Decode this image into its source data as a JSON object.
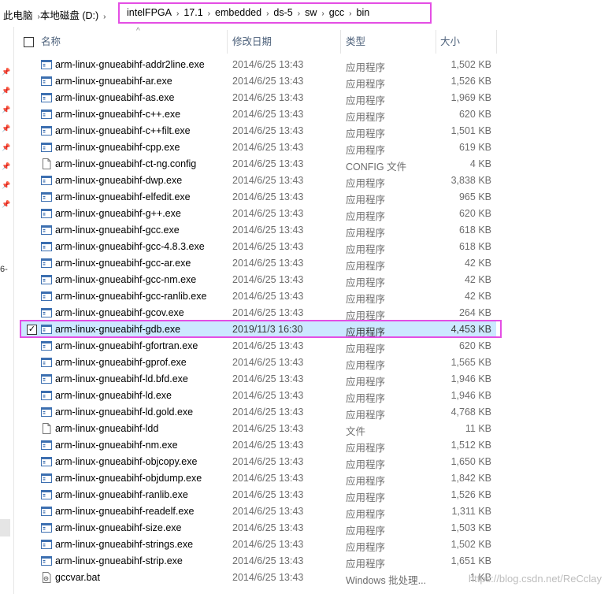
{
  "breadcrumb": {
    "prefix": [
      "此电脑",
      "本地磁盘 (D:)"
    ],
    "items": [
      "intelFPGA",
      "17.1",
      "embedded",
      "ds-5",
      "sw",
      "gcc",
      "bin"
    ]
  },
  "nav": {
    "partial_text": "6-"
  },
  "columns": {
    "name": "名称",
    "date": "修改日期",
    "type": "类型",
    "size": "大小"
  },
  "files": [
    {
      "name": "arm-linux-gnueabihf-addr2line.exe",
      "date": "2014/6/25 13:43",
      "type": "应用程序",
      "size": "1,502 KB",
      "icon": "exe-icon"
    },
    {
      "name": "arm-linux-gnueabihf-ar.exe",
      "date": "2014/6/25 13:43",
      "type": "应用程序",
      "size": "1,526 KB",
      "icon": "exe-icon"
    },
    {
      "name": "arm-linux-gnueabihf-as.exe",
      "date": "2014/6/25 13:43",
      "type": "应用程序",
      "size": "1,969 KB",
      "icon": "exe-icon"
    },
    {
      "name": "arm-linux-gnueabihf-c++.exe",
      "date": "2014/6/25 13:43",
      "type": "应用程序",
      "size": "620 KB",
      "icon": "exe-icon"
    },
    {
      "name": "arm-linux-gnueabihf-c++filt.exe",
      "date": "2014/6/25 13:43",
      "type": "应用程序",
      "size": "1,501 KB",
      "icon": "exe-icon"
    },
    {
      "name": "arm-linux-gnueabihf-cpp.exe",
      "date": "2014/6/25 13:43",
      "type": "应用程序",
      "size": "619 KB",
      "icon": "exe-icon"
    },
    {
      "name": "arm-linux-gnueabihf-ct-ng.config",
      "date": "2014/6/25 13:43",
      "type": "CONFIG 文件",
      "size": "4 KB",
      "icon": "file-icon"
    },
    {
      "name": "arm-linux-gnueabihf-dwp.exe",
      "date": "2014/6/25 13:43",
      "type": "应用程序",
      "size": "3,838 KB",
      "icon": "exe-icon"
    },
    {
      "name": "arm-linux-gnueabihf-elfedit.exe",
      "date": "2014/6/25 13:43",
      "type": "应用程序",
      "size": "965 KB",
      "icon": "exe-icon"
    },
    {
      "name": "arm-linux-gnueabihf-g++.exe",
      "date": "2014/6/25 13:43",
      "type": "应用程序",
      "size": "620 KB",
      "icon": "exe-icon"
    },
    {
      "name": "arm-linux-gnueabihf-gcc.exe",
      "date": "2014/6/25 13:43",
      "type": "应用程序",
      "size": "618 KB",
      "icon": "exe-icon"
    },
    {
      "name": "arm-linux-gnueabihf-gcc-4.8.3.exe",
      "date": "2014/6/25 13:43",
      "type": "应用程序",
      "size": "618 KB",
      "icon": "exe-icon"
    },
    {
      "name": "arm-linux-gnueabihf-gcc-ar.exe",
      "date": "2014/6/25 13:43",
      "type": "应用程序",
      "size": "42 KB",
      "icon": "exe-icon"
    },
    {
      "name": "arm-linux-gnueabihf-gcc-nm.exe",
      "date": "2014/6/25 13:43",
      "type": "应用程序",
      "size": "42 KB",
      "icon": "exe-icon"
    },
    {
      "name": "arm-linux-gnueabihf-gcc-ranlib.exe",
      "date": "2014/6/25 13:43",
      "type": "应用程序",
      "size": "42 KB",
      "icon": "exe-icon"
    },
    {
      "name": "arm-linux-gnueabihf-gcov.exe",
      "date": "2014/6/25 13:43",
      "type": "应用程序",
      "size": "264 KB",
      "icon": "exe-icon"
    },
    {
      "name": "arm-linux-gnueabihf-gdb.exe",
      "date": "2019/11/3 16:30",
      "type": "应用程序",
      "size": "4,453 KB",
      "icon": "exe-icon",
      "selected": true
    },
    {
      "name": "arm-linux-gnueabihf-gfortran.exe",
      "date": "2014/6/25 13:43",
      "type": "应用程序",
      "size": "620 KB",
      "icon": "exe-icon"
    },
    {
      "name": "arm-linux-gnueabihf-gprof.exe",
      "date": "2014/6/25 13:43",
      "type": "应用程序",
      "size": "1,565 KB",
      "icon": "exe-icon"
    },
    {
      "name": "arm-linux-gnueabihf-ld.bfd.exe",
      "date": "2014/6/25 13:43",
      "type": "应用程序",
      "size": "1,946 KB",
      "icon": "exe-icon"
    },
    {
      "name": "arm-linux-gnueabihf-ld.exe",
      "date": "2014/6/25 13:43",
      "type": "应用程序",
      "size": "1,946 KB",
      "icon": "exe-icon"
    },
    {
      "name": "arm-linux-gnueabihf-ld.gold.exe",
      "date": "2014/6/25 13:43",
      "type": "应用程序",
      "size": "4,768 KB",
      "icon": "exe-icon"
    },
    {
      "name": "arm-linux-gnueabihf-ldd",
      "date": "2014/6/25 13:43",
      "type": "文件",
      "size": "11 KB",
      "icon": "file-icon"
    },
    {
      "name": "arm-linux-gnueabihf-nm.exe",
      "date": "2014/6/25 13:43",
      "type": "应用程序",
      "size": "1,512 KB",
      "icon": "exe-icon"
    },
    {
      "name": "arm-linux-gnueabihf-objcopy.exe",
      "date": "2014/6/25 13:43",
      "type": "应用程序",
      "size": "1,650 KB",
      "icon": "exe-icon"
    },
    {
      "name": "arm-linux-gnueabihf-objdump.exe",
      "date": "2014/6/25 13:43",
      "type": "应用程序",
      "size": "1,842 KB",
      "icon": "exe-icon"
    },
    {
      "name": "arm-linux-gnueabihf-ranlib.exe",
      "date": "2014/6/25 13:43",
      "type": "应用程序",
      "size": "1,526 KB",
      "icon": "exe-icon"
    },
    {
      "name": "arm-linux-gnueabihf-readelf.exe",
      "date": "2014/6/25 13:43",
      "type": "应用程序",
      "size": "1,311 KB",
      "icon": "exe-icon"
    },
    {
      "name": "arm-linux-gnueabihf-size.exe",
      "date": "2014/6/25 13:43",
      "type": "应用程序",
      "size": "1,503 KB",
      "icon": "exe-icon"
    },
    {
      "name": "arm-linux-gnueabihf-strings.exe",
      "date": "2014/6/25 13:43",
      "type": "应用程序",
      "size": "1,502 KB",
      "icon": "exe-icon"
    },
    {
      "name": "arm-linux-gnueabihf-strip.exe",
      "date": "2014/6/25 13:43",
      "type": "应用程序",
      "size": "1,651 KB",
      "icon": "exe-icon"
    },
    {
      "name": "gccvar.bat",
      "date": "2014/6/25 13:43",
      "type": "Windows 批处理...",
      "size": "1 KB",
      "icon": "bat-icon"
    }
  ],
  "watermark": "https://blog.csdn.net/ReCclay",
  "colors": {
    "highlight": "#e44ee4",
    "selection": "#cce8ff",
    "header_text": "#4c607a",
    "meta_text": "#6d6d6d"
  }
}
